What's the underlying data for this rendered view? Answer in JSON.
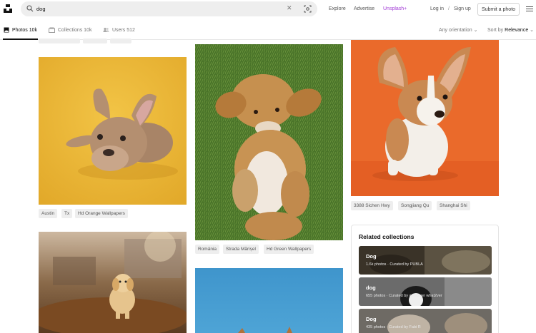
{
  "header": {
    "search_value": "dog",
    "nav": {
      "explore": "Explore",
      "advertise": "Advertise",
      "plus": "Unsplash+",
      "login": "Log in",
      "slash": "/",
      "signup": "Sign up"
    },
    "submit_label": "Submit a photo"
  },
  "tabs": [
    {
      "label": "Photos 10k"
    },
    {
      "label": "Collections 10k"
    },
    {
      "label": "Users 512"
    }
  ],
  "filters": {
    "orientation": "Any orientation",
    "sort_prefix": "Sort by",
    "sort_value": "Relevance"
  },
  "photos": {
    "col1_tags": [
      "Austin",
      "Tx",
      "Hd Orange Wallpapers"
    ],
    "col2_tags": [
      "România",
      "Strada Mărișel",
      "Hd Green Wallpapers"
    ],
    "col3_tags": [
      "3388 Sichen Hwy",
      "Songjiang Qu",
      "Shanghai Shi"
    ]
  },
  "related": {
    "title": "Related collections",
    "items": [
      {
        "title": "Dog",
        "meta": "1.6k photos · Curated by PUBLA"
      },
      {
        "title": "dog",
        "meta": "655 photos · Curated by what2ver what2ver"
      },
      {
        "title": "Dog",
        "meta": "435 photos · Curated by Fabi R"
      }
    ]
  },
  "colors": {
    "accent_plus": "#a23cd6",
    "tag_bg": "#eeeeee",
    "search_bg": "#eeeeee"
  }
}
